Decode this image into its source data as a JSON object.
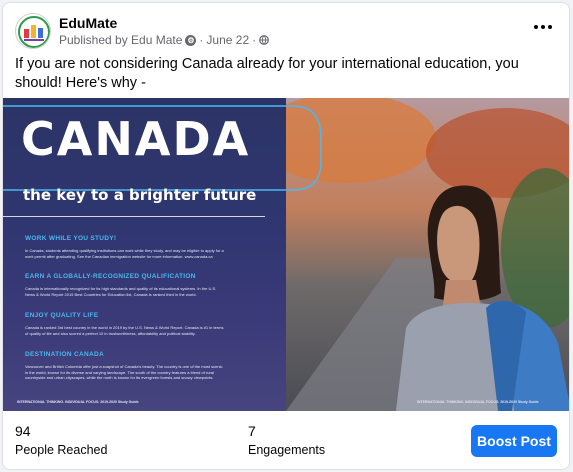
{
  "post": {
    "page_name": "EduMate",
    "published_by": "Published by Edu Mate",
    "date": "June 22",
    "text": "If you are not considering Canada already for your international education, you should! Here's why -"
  },
  "media": {
    "headline": "CANADA",
    "tagline": "the key to a brighter future",
    "sections": [
      {
        "heading": "WORK WHILE YOU STUDY!",
        "body": "In Canada, students attending qualifying institutions can work while they study, and may be eligible to apply for a work permit after graduating. See the Canadian immigration website for more information. www.canada.ca"
      },
      {
        "heading": "EARN A GLOBALLY-RECOGNIZED QUALIFICATION",
        "body": "Canada is internationally recognized for its high standards and quality of its educational systems. In the U.S. News & World Report 2019 Best Countries for Education list, Canada is ranked third in the world."
      },
      {
        "heading": "ENJOY QUALITY LIFE",
        "body": "Canada is ranked 3rd best country in the world in 2019 by the U.S. News & World Report. Canada is #1 in terms of quality of life and also scored a perfect 10 in trustworthiness, affordability and political stability."
      },
      {
        "heading": "DESTINATION CANADA",
        "body": "Vancouver and British Columbia offer just a snapshot of Canada's beauty. The country is one of the most scenic in the world, known for its diverse and varying landscape. The south of the country features a blend of rural countryside and urban cityscapes, while the north is known for its evergreen forests and snowy viewpoints."
      }
    ],
    "footer_left": "INTERNATIONAL THINKING. INDIVIDUAL FOCUS. 2019-2020 Study Guide",
    "footer_right": "INTERNATIONAL THINKING. INDIVIDUAL FOCUS. 2019-2020 Study Guide"
  },
  "stats": {
    "reached_value": "94",
    "reached_label": "People Reached",
    "engagements_value": "7",
    "engagements_label": "Engagements"
  },
  "actions": {
    "boost_label": "Boost Post"
  },
  "colors": {
    "boost": "#1877f2",
    "accent_blue": "#4ab8ee",
    "panel": "#2f3670"
  },
  "icons": [
    "edumate-logo-icon",
    "settings-gear-icon",
    "globe-icon",
    "more-options-icon"
  ]
}
